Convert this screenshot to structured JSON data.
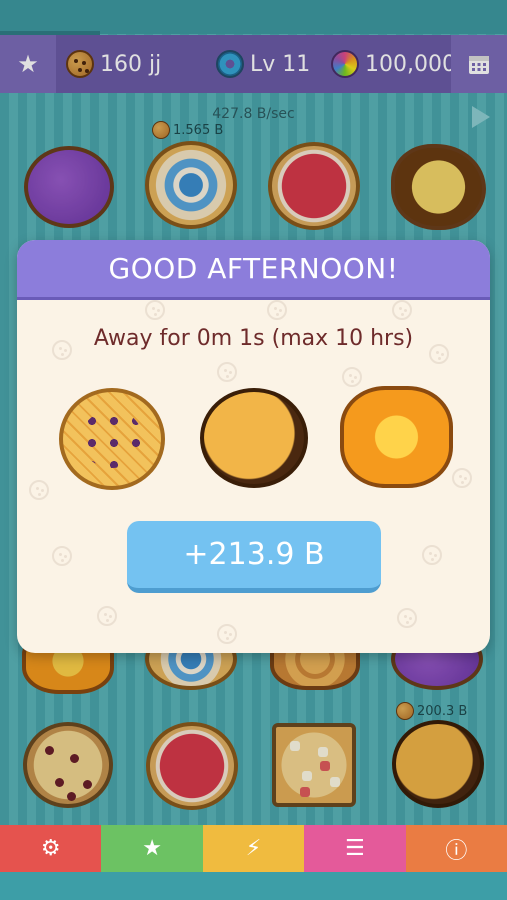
{
  "topbar": {
    "stats": [
      {
        "icon": "cookie-coin-icon",
        "value": "160 jj"
      },
      {
        "icon": "donut-icon",
        "value": "Lv 11"
      },
      {
        "icon": "rainbow-donut-icon",
        "value": "100,000"
      }
    ],
    "left_button_icon": "star-icon",
    "right_button_icon": "calendar-icon"
  },
  "rate": "427.8 B/sec",
  "cookie_earnings": [
    "1.565 B",
    "200.3 B"
  ],
  "modal": {
    "title": "GOOD AFTERNOON!",
    "away_text": "Away for 0m 1s (max 10 hrs)",
    "claim_label": "+213.9 B",
    "rewards": [
      "waffle-pie-cookie",
      "dark-round-cookie",
      "flower-cookie"
    ]
  },
  "bottom_nav": [
    {
      "icon": "gear-icon",
      "glyph": "⚙",
      "color": "#e5534e"
    },
    {
      "icon": "star-icon",
      "glyph": "★",
      "color": "#6cc263"
    },
    {
      "icon": "lightning-icon",
      "glyph": "⚡",
      "color": "#f0bb3f"
    },
    {
      "icon": "list-icon",
      "glyph": "☰",
      "color": "#e45a9a"
    },
    {
      "icon": "info-icon",
      "glyph": "ⓘ",
      "color": "#ea7c43"
    }
  ]
}
